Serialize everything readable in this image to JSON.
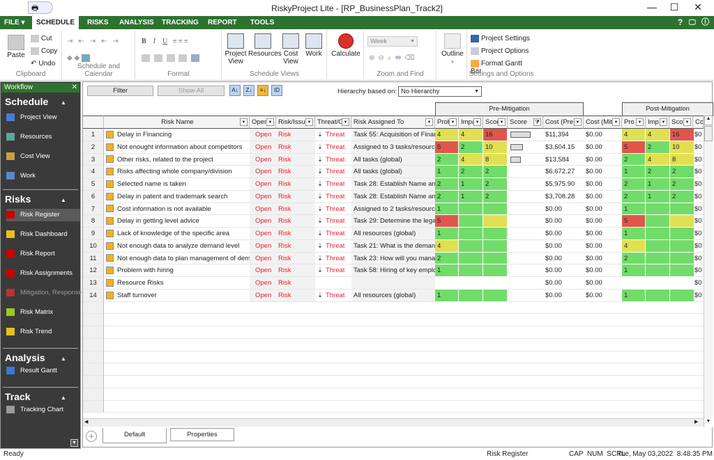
{
  "window": {
    "title": "RiskyProject Lite - [RP_BusinessPlan_Track2]",
    "minimize": "—",
    "maximize": "☐",
    "close": "✕"
  },
  "menu": {
    "tabs": [
      "FILE ▾",
      "SCHEDULE",
      "RISKS",
      "ANALYSIS",
      "TRACKING",
      "REPORT",
      "TOOLS"
    ],
    "active": "SCHEDULE",
    "right": [
      "?",
      "🖵",
      "ⓘ"
    ]
  },
  "ribbon": {
    "clipboard": {
      "paste": "Paste",
      "cut": "Cut",
      "copy": "Copy",
      "undo": "Undo",
      "label": "Clipboard"
    },
    "schedule_calendar": {
      "label": "Schedule and Calendar"
    },
    "format": {
      "bold": "B",
      "italic": "I",
      "underline": "U",
      "label": "Format"
    },
    "schedule_views": {
      "items": [
        "Project View",
        "Resources",
        "Cost View",
        "Work"
      ],
      "label": "Schedule Views"
    },
    "calculate": "Calculate",
    "zoom_find": {
      "select": "Week",
      "label": "Zoom and Find"
    },
    "outline": "Outline",
    "settings": {
      "items": [
        "Project Settings",
        "Project Options",
        "Format Gantt Bar"
      ],
      "label": "Settings and Options"
    }
  },
  "sidebar": {
    "header": "Workflow",
    "close": "✕",
    "sections": [
      {
        "title": "Schedule",
        "items": [
          "Project View",
          "Resources",
          "Cost View",
          "Work"
        ]
      },
      {
        "title": "Risks",
        "items": [
          "Risk Register",
          "Risk Dashboard",
          "Risk Report",
          "Risk Assignments",
          "Mitigation, Response",
          "Risk Matrix",
          "Risk Trend"
        ]
      },
      {
        "title": "Analysis",
        "items": [
          "Result Gantt"
        ]
      },
      {
        "title": "Track",
        "items": [
          "Tracking Chart"
        ]
      }
    ],
    "selected": "Risk Register"
  },
  "toolbar": {
    "filter": "Filter",
    "show_all": "Show All",
    "hierarchy_label": "Hierarchy based on:",
    "hierarchy_value": "No Hierarchy"
  },
  "grid": {
    "groups": {
      "pre": "Pre-Mitigation",
      "post": "Post-Mitigation"
    },
    "columns": [
      "Risk Name",
      "Open",
      "Risk/Issue",
      "Threat/O",
      "Risk Assigned To",
      "Prob",
      "Impact",
      "Score",
      "Score",
      "Cost (Pre",
      "Cost (Miti",
      "Pro",
      "Imp",
      "Sco",
      "Co"
    ],
    "colors": {
      "red": "#e0574a",
      "yellow": "#e0e052",
      "green": "#72dc6a"
    },
    "rows": [
      {
        "n": "1",
        "name": "Delay in Financing",
        "status": "Open",
        "type": "Risk",
        "threat": "Threat",
        "assigned": "Task 55: Acquisition of Financ",
        "pre": [
          [
            "4",
            "yellow"
          ],
          [
            "4",
            "yellow"
          ],
          [
            "16",
            "red"
          ]
        ],
        "score": 16,
        "cost_pre": "$11,394",
        "cost_miti": "$0.00",
        "post": [
          [
            "4",
            "yellow"
          ],
          [
            "4",
            "yellow"
          ],
          [
            "16",
            "red"
          ]
        ],
        "co": "$0"
      },
      {
        "n": "2",
        "name": "Not enought information about competitors",
        "status": "Open",
        "type": "Risk",
        "threat": "Threat",
        "assigned": "Assigned to 3 tasks/resource",
        "pre": [
          [
            "5",
            "red"
          ],
          [
            "2",
            "green"
          ],
          [
            "10",
            "yellow"
          ]
        ],
        "score": 10,
        "cost_pre": "$3,604.15",
        "cost_miti": "$0.00",
        "post": [
          [
            "5",
            "red"
          ],
          [
            "2",
            "green"
          ],
          [
            "10",
            "yellow"
          ]
        ],
        "co": "$0"
      },
      {
        "n": "3",
        "name": "Other risks, related to the project",
        "status": "Open",
        "type": "Risk",
        "threat": "Threat",
        "assigned": "All tasks (global)",
        "pre": [
          [
            "2",
            "green"
          ],
          [
            "4",
            "yellow"
          ],
          [
            "8",
            "yellow"
          ]
        ],
        "score": 8,
        "cost_pre": "$13,584",
        "cost_miti": "$0.00",
        "post": [
          [
            "2",
            "green"
          ],
          [
            "4",
            "yellow"
          ],
          [
            "8",
            "yellow"
          ]
        ],
        "co": "$0"
      },
      {
        "n": "4",
        "name": "Risks affecting whole company/division",
        "status": "Open",
        "type": "Risk",
        "threat": "Threat",
        "assigned": "All tasks (global)",
        "pre": [
          [
            "1",
            "green"
          ],
          [
            "2",
            "green"
          ],
          [
            "2",
            "green"
          ]
        ],
        "score": 0,
        "cost_pre": "$6,672.27",
        "cost_miti": "$0.00",
        "post": [
          [
            "1",
            "green"
          ],
          [
            "2",
            "green"
          ],
          [
            "2",
            "green"
          ]
        ],
        "co": "$0"
      },
      {
        "n": "5",
        "name": "Selected name is taken",
        "status": "Open",
        "type": "Risk",
        "threat": "Threat",
        "assigned": "Task 28: Establish Name and",
        "pre": [
          [
            "2",
            "green"
          ],
          [
            "1",
            "green"
          ],
          [
            "2",
            "green"
          ]
        ],
        "score": 0,
        "cost_pre": "$5,975.90",
        "cost_miti": "$0.00",
        "post": [
          [
            "2",
            "green"
          ],
          [
            "1",
            "green"
          ],
          [
            "2",
            "green"
          ]
        ],
        "co": "$0"
      },
      {
        "n": "6",
        "name": "Delay in patent and trademark search",
        "status": "Open",
        "type": "Risk",
        "threat": "Threat",
        "assigned": "Task 28: Establish Name and",
        "pre": [
          [
            "2",
            "green"
          ],
          [
            "1",
            "green"
          ],
          [
            "2",
            "green"
          ]
        ],
        "score": 0,
        "cost_pre": "$3,708.28",
        "cost_miti": "$0.00",
        "post": [
          [
            "2",
            "green"
          ],
          [
            "1",
            "green"
          ],
          [
            "2",
            "green"
          ]
        ],
        "co": "$0"
      },
      {
        "n": "7",
        "name": "Cost information is not available",
        "status": "Open",
        "type": "Risk",
        "threat": "Threat",
        "assigned": "Assigned to 2 tasks/resource",
        "pre": [
          [
            "1",
            "green"
          ],
          [
            "",
            "green"
          ],
          [
            "",
            "green"
          ]
        ],
        "score": 0,
        "cost_pre": "$0.00",
        "cost_miti": "$0.00",
        "post": [
          [
            "1",
            "green"
          ],
          [
            "",
            "green"
          ],
          [
            "",
            "green"
          ]
        ],
        "co": "$0"
      },
      {
        "n": "8",
        "name": "Delay in getting level advice",
        "status": "Open",
        "type": "Risk",
        "threat": "Threat",
        "assigned": "Task 29: Determine the legal t",
        "pre": [
          [
            "5",
            "red"
          ],
          [
            "",
            "green"
          ],
          [
            "",
            "yellow"
          ]
        ],
        "score": 0,
        "cost_pre": "$0.00",
        "cost_miti": "$0.00",
        "post": [
          [
            "5",
            "red"
          ],
          [
            "",
            "green"
          ],
          [
            "",
            "yellow"
          ]
        ],
        "co": "$0"
      },
      {
        "n": "9",
        "name": "Lack of knowledge of the specific area",
        "status": "Open",
        "type": "Risk",
        "threat": "Threat",
        "assigned": "All resources (global)",
        "pre": [
          [
            "1",
            "green"
          ],
          [
            "",
            "green"
          ],
          [
            "",
            "green"
          ]
        ],
        "score": 0,
        "cost_pre": "$0.00",
        "cost_miti": "$0.00",
        "post": [
          [
            "1",
            "green"
          ],
          [
            "",
            "green"
          ],
          [
            "",
            "green"
          ]
        ],
        "co": "$0"
      },
      {
        "n": "10",
        "name": "Not enough data to analyze demand level",
        "status": "Open",
        "type": "Risk",
        "threat": "Threat",
        "assigned": "Task 21: What is the demand",
        "pre": [
          [
            "4",
            "yellow"
          ],
          [
            "",
            "green"
          ],
          [
            "",
            "green"
          ]
        ],
        "score": 0,
        "cost_pre": "$0.00",
        "cost_miti": "$0.00",
        "post": [
          [
            "4",
            "yellow"
          ],
          [
            "",
            "green"
          ],
          [
            "",
            "green"
          ]
        ],
        "co": "$0"
      },
      {
        "n": "11",
        "name": "Not enough data to plan management of demand",
        "status": "Open",
        "type": "Risk",
        "threat": "Threat",
        "assigned": "Task 23: How will you manag",
        "pre": [
          [
            "2",
            "green"
          ],
          [
            "",
            "green"
          ],
          [
            "",
            "green"
          ]
        ],
        "score": 0,
        "cost_pre": "$0.00",
        "cost_miti": "$0.00",
        "post": [
          [
            "2",
            "green"
          ],
          [
            "",
            "green"
          ],
          [
            "",
            "green"
          ]
        ],
        "co": "$0"
      },
      {
        "n": "12",
        "name": "Problem with hiring",
        "status": "Open",
        "type": "Risk",
        "threat": "Threat",
        "assigned": "Task 58: Hiring of key employ",
        "pre": [
          [
            "1",
            "green"
          ],
          [
            "",
            "green"
          ],
          [
            "",
            "green"
          ]
        ],
        "score": 0,
        "cost_pre": "$0.00",
        "cost_miti": "$0.00",
        "post": [
          [
            "1",
            "green"
          ],
          [
            "",
            "green"
          ],
          [
            "",
            "green"
          ]
        ],
        "co": "$0"
      },
      {
        "n": "13",
        "name": "Resource Risks",
        "status": "Open",
        "type": "Risk",
        "threat": "",
        "assigned": "",
        "pre": null,
        "score": 0,
        "cost_pre": "$0.00",
        "cost_miti": "$0.00",
        "post": null,
        "co": "$0"
      },
      {
        "n": "14",
        "name": "Staff turnover",
        "status": "Open",
        "type": "Risk",
        "threat": "Threat",
        "assigned": "All resources (global)",
        "pre": [
          [
            "1",
            "green"
          ],
          [
            "",
            "green"
          ],
          [
            "",
            "green"
          ]
        ],
        "score": 0,
        "cost_pre": "$0.00",
        "cost_miti": "$0.00",
        "post": [
          [
            "1",
            "green"
          ],
          [
            "",
            "green"
          ],
          [
            "",
            "green"
          ]
        ],
        "co": "$0"
      }
    ]
  },
  "tabs": {
    "default": "Default",
    "properties": "Properties"
  },
  "status": {
    "left": "Ready",
    "view": "Risk Register",
    "indicators": "CAP  NUM  SCRL",
    "datetime": "Tue, May 03,2022  8:48:35 PM"
  }
}
